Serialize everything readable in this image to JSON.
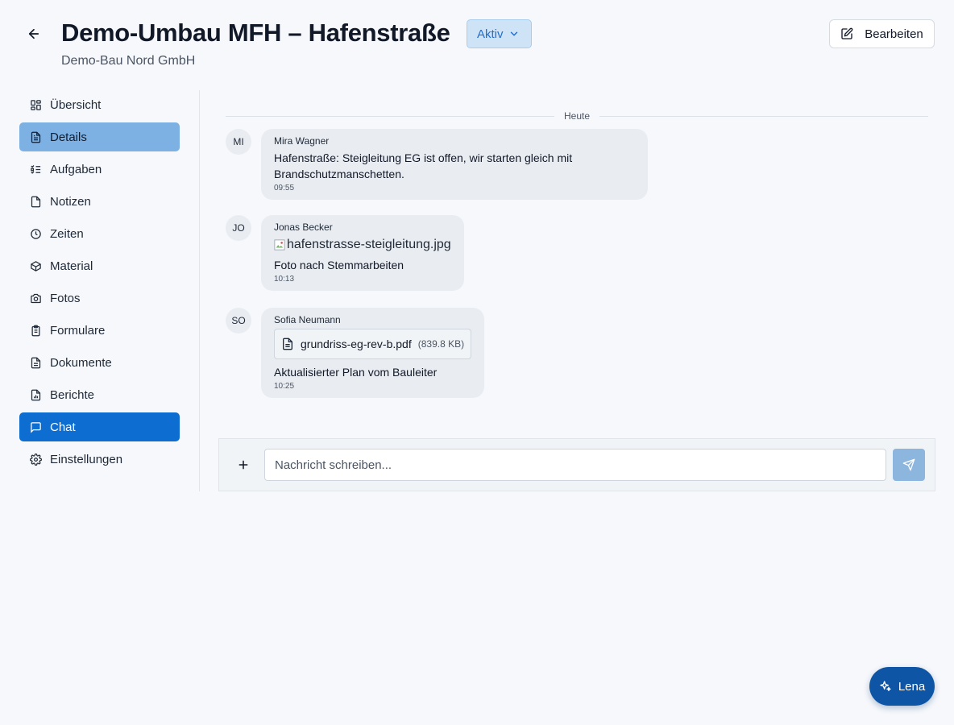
{
  "header": {
    "title": "Demo-Umbau MFH – Hafenstraße",
    "status": "Aktiv",
    "company": "Demo-Bau Nord GmbH",
    "edit_label": "Bearbeiten"
  },
  "sidebar": {
    "items": [
      {
        "label": "Übersicht",
        "icon": "grid-icon"
      },
      {
        "label": "Details",
        "icon": "file-text-icon",
        "state": "highlighted"
      },
      {
        "label": "Aufgaben",
        "icon": "list-check-icon"
      },
      {
        "label": "Notizen",
        "icon": "note-icon"
      },
      {
        "label": "Zeiten",
        "icon": "clock-icon"
      },
      {
        "label": "Material",
        "icon": "package-icon"
      },
      {
        "label": "Fotos",
        "icon": "camera-icon"
      },
      {
        "label": "Formulare",
        "icon": "clipboard-icon"
      },
      {
        "label": "Dokumente",
        "icon": "document-icon"
      },
      {
        "label": "Berichte",
        "icon": "report-icon"
      },
      {
        "label": "Chat",
        "icon": "chat-icon",
        "state": "active"
      },
      {
        "label": "Einstellungen",
        "icon": "gear-icon"
      }
    ]
  },
  "chat": {
    "day_label": "Heute",
    "messages": [
      {
        "initials": "MI",
        "sender": "Mira Wagner",
        "text": "Hafenstraße: Steigleitung EG ist offen, wir starten gleich mit Brandschutzmanschetten.",
        "time": "09:55"
      },
      {
        "initials": "JO",
        "sender": "Jonas Becker",
        "image_alt": "hafenstrasse-steigleitung.jpg",
        "text": "Foto nach Stemmarbeiten",
        "time": "10:13"
      },
      {
        "initials": "SO",
        "sender": "Sofia Neumann",
        "file_name": "grundriss-eg-rev-b.pdf",
        "file_size": "(839.8 KB)",
        "text": "Aktualisierter Plan vom Bauleiter",
        "time": "10:25"
      }
    ]
  },
  "composer": {
    "placeholder": "Nachricht schreiben..."
  },
  "assistant": {
    "label": "Lena"
  },
  "colors": {
    "accent": "#0d6dd0",
    "highlight": "#7db1e3",
    "status_bg": "#cfe3f7",
    "assistant": "#0e55a6"
  }
}
